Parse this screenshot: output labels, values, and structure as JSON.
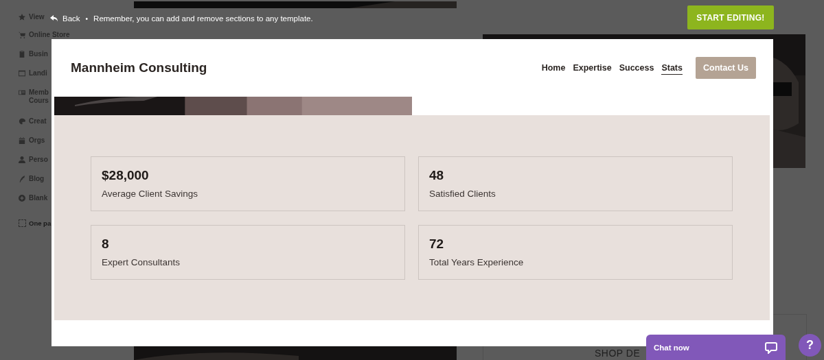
{
  "background": {
    "sidebar": [
      {
        "kind": "star",
        "label": "View"
      },
      {
        "kind": "cart",
        "label": "Online Store"
      },
      {
        "kind": "clipboard",
        "label": "Busin"
      },
      {
        "kind": "window",
        "label": "Landi"
      },
      {
        "kind": "card",
        "label": "Memb",
        "sub": "Cours"
      },
      {
        "kind": "palette",
        "label": "Creat"
      },
      {
        "kind": "calendar",
        "label": "Orgs"
      },
      {
        "kind": "person",
        "label": "Perso"
      },
      {
        "kind": "quill",
        "label": "Blog"
      },
      {
        "kind": "plus",
        "label": "Blank"
      }
    ],
    "one_page": {
      "label": "One pa",
      "checked": false
    },
    "shop_heading": "SHOP DE"
  },
  "preview_bar": {
    "back": "Back",
    "separator": "•",
    "message": "Remember, you can add and remove sections to any template.",
    "start_button": "START EDITING!"
  },
  "site": {
    "brand": "Mannheim Consulting",
    "nav": [
      {
        "label": "Home",
        "selected": false
      },
      {
        "label": "Expertise",
        "selected": false
      },
      {
        "label": "Success",
        "selected": false
      },
      {
        "label": "Stats",
        "selected": true
      }
    ],
    "contact_button": "Contact Us",
    "stats": [
      {
        "value": "$28,000",
        "label": "Average Client Savings"
      },
      {
        "value": "48",
        "label": "Satisfied Clients"
      },
      {
        "value": "8",
        "label": "Expert Consultants"
      },
      {
        "value": "72",
        "label": "Total Years Experience"
      }
    ]
  },
  "chat": {
    "label": "Chat now"
  },
  "help_button": "?"
}
